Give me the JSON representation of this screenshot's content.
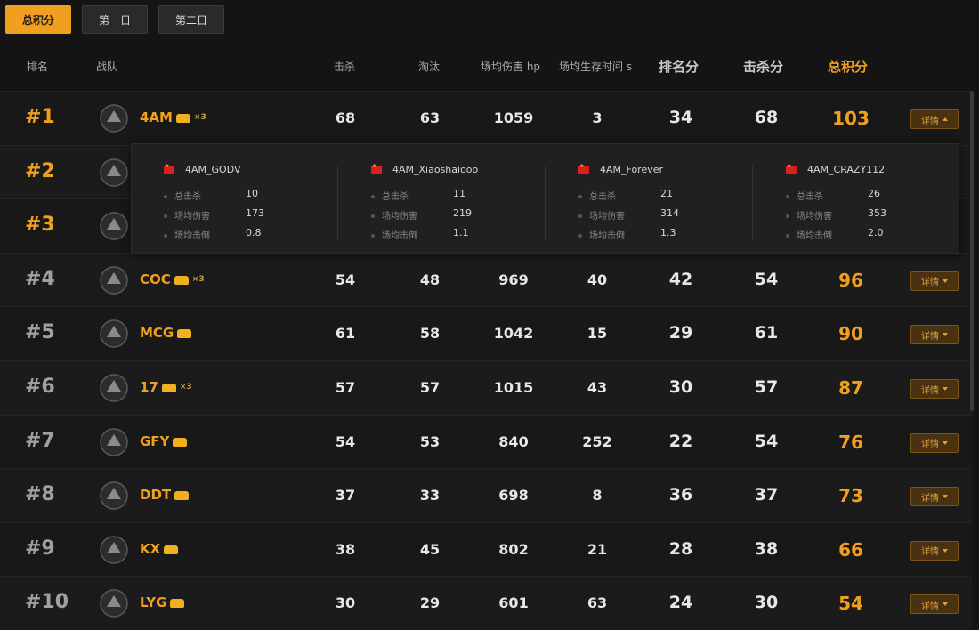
{
  "tabs": [
    "总积分",
    "第一日",
    "第二日"
  ],
  "columns": {
    "rank": "排名",
    "team": "战队",
    "kills_small": "击杀",
    "eliminations": "淘汰",
    "avg_damage": "场均伤害 hp",
    "avg_survival": "场均生存时间 s",
    "rank_points": "排名分",
    "kill_points": "击杀分",
    "total_points": "总积分"
  },
  "detail_label": "详情",
  "rows": [
    {
      "rank": "#1",
      "team": "4AM",
      "mult": "×3",
      "kills": "68",
      "elims": "63",
      "damage": "1059",
      "survival": "3",
      "rank_pts": "34",
      "kill_pts": "68",
      "total": "103",
      "logo": "4AM"
    },
    {
      "rank": "#2",
      "team": "",
      "mult": "",
      "kills": "",
      "elims": "",
      "damage": "",
      "survival": "",
      "rank_pts": "",
      "kill_pts": "",
      "total": "",
      "logo": "wolf"
    },
    {
      "rank": "#3",
      "team": "",
      "mult": "",
      "kills": "",
      "elims": "",
      "damage": "",
      "survival": "",
      "rank_pts": "",
      "kill_pts": "",
      "total": "",
      "logo": "green"
    },
    {
      "rank": "#4",
      "team": "COC",
      "mult": "×3",
      "kills": "54",
      "elims": "48",
      "damage": "969",
      "survival": "40",
      "rank_pts": "42",
      "kill_pts": "54",
      "total": "96",
      "logo": "COC"
    },
    {
      "rank": "#5",
      "team": "MCG",
      "mult": "",
      "kills": "61",
      "elims": "58",
      "damage": "1042",
      "survival": "15",
      "rank_pts": "29",
      "kill_pts": "61",
      "total": "90",
      "logo": "MCG"
    },
    {
      "rank": "#6",
      "team": "17",
      "mult": "×3",
      "kills": "57",
      "elims": "57",
      "damage": "1015",
      "survival": "43",
      "rank_pts": "30",
      "kill_pts": "57",
      "total": "87",
      "logo": "17"
    },
    {
      "rank": "#7",
      "team": "GFY",
      "mult": "",
      "kills": "54",
      "elims": "53",
      "damage": "840",
      "survival": "252",
      "rank_pts": "22",
      "kill_pts": "54",
      "total": "76",
      "logo": "GFY"
    },
    {
      "rank": "#8",
      "team": "DDT",
      "mult": "",
      "kills": "37",
      "elims": "33",
      "damage": "698",
      "survival": "8",
      "rank_pts": "36",
      "kill_pts": "37",
      "total": "73",
      "logo": "DDT"
    },
    {
      "rank": "#9",
      "team": "KX",
      "mult": "",
      "kills": "38",
      "elims": "45",
      "damage": "802",
      "survival": "21",
      "rank_pts": "28",
      "kill_pts": "38",
      "total": "66",
      "logo": "KX"
    },
    {
      "rank": "#10",
      "team": "LYG",
      "mult": "",
      "kills": "30",
      "elims": "29",
      "damage": "601",
      "survival": "63",
      "rank_pts": "24",
      "kill_pts": "30",
      "total": "54",
      "logo": "LYG"
    }
  ],
  "popup": {
    "stat_labels": [
      "总击杀",
      "场均伤害",
      "场均击倒"
    ],
    "players": [
      {
        "name": "4AM_GODV",
        "kills": "10",
        "damage": "173",
        "knock": "0.8"
      },
      {
        "name": "4AM_Xiaoshaiooo",
        "kills": "11",
        "damage": "219",
        "knock": "1.1"
      },
      {
        "name": "4AM_Forever",
        "kills": "21",
        "damage": "314",
        "knock": "1.3"
      },
      {
        "name": "4AM_CRAZY112",
        "kills": "26",
        "damage": "353",
        "knock": "2.0"
      }
    ]
  },
  "colors": {
    "accent": "#f0a01e",
    "bg": "#141414",
    "row": "#181818"
  }
}
